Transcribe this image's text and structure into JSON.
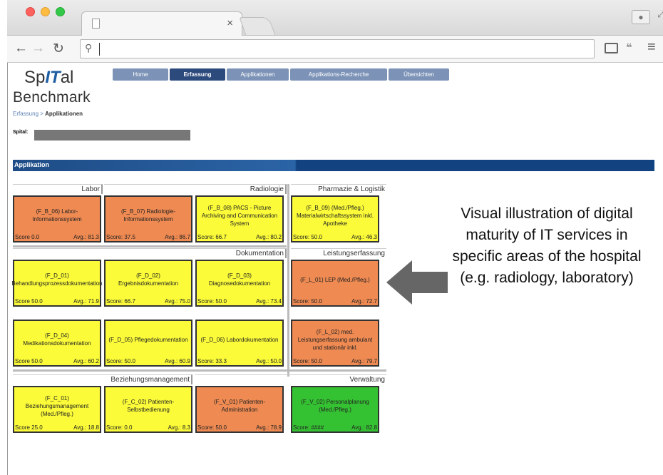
{
  "browser": {
    "tab_close": "×",
    "omnibox_value": "",
    "icons": [
      "back-icon",
      "forward-icon",
      "reload-icon",
      "search-icon",
      "cast-icon",
      "extension-icon",
      "menu-icon"
    ]
  },
  "logo": {
    "part1": "Sp",
    "part2": "IT",
    "part3": "al",
    "line2": "Benchmark"
  },
  "nav": [
    "Home",
    "Erfassung",
    "Applikationen",
    "Applikations-Recherche",
    "Übersichten"
  ],
  "breadcrumb": {
    "first": "Erfassung",
    "sep": " > ",
    "current": "Applikationen"
  },
  "spital_label": "Spital:",
  "section_title": "Applikation",
  "groups": {
    "labor": "Labor",
    "radiologie": "Radiologie",
    "pharmazie": "Pharmazie & Logistik",
    "dokumentation": "Dokumentation",
    "leistung": "Leistungserfassung",
    "beziehung": "Beziehungsmanagement",
    "verwaltung": "Verwaltung"
  },
  "cards": {
    "b06": {
      "title": "(F_B_06) Labor-Informationssystem",
      "score": "Score 0.0",
      "avg": "Avg.: 81.3"
    },
    "b07": {
      "title": "(F_B_07) Radiologie-Informationssystem",
      "score": "Score: 37.5",
      "avg": "Avg.: 86.7"
    },
    "b08": {
      "title": "(F_B_08) PACS - Picture Archiving and Communication System",
      "score": "Score: 66.7",
      "avg": "Avg.: 80.2"
    },
    "b09": {
      "title": "(F_B_09) (Med./Pfleg.) Materialwirtschaftssystem inkl. Apotheke",
      "score": "Score: 50.0",
      "avg": "Avg.: 46.3"
    },
    "d01": {
      "title": "(F_D_01) Behandlungsprozessdokumentation",
      "score": "Score 50.0",
      "avg": "Avg.: 71.9"
    },
    "d02": {
      "title": "(F_D_02) Ergebnisdokumentation",
      "score": "Score: 66.7",
      "avg": "Avg.: 75.0"
    },
    "d03": {
      "title": "(F_D_03) Diagnosedokumentation",
      "score": "Score: 50.0",
      "avg": "Avg.: 73.4"
    },
    "l01": {
      "title": "(F_L_01) LEP (Med./Pfleg.)",
      "score": "Score: 50.0",
      "avg": "Avg.: 72.7"
    },
    "d04": {
      "title": "(F_D_04) Medikationsdokumentation",
      "score": "Score 50.0",
      "avg": "Avg.: 60.2"
    },
    "d05": {
      "title": "(F_D_05) Pflegedokumentation",
      "score": "Score: 50.0",
      "avg": "Avg.: 60.9"
    },
    "d06": {
      "title": "(F_D_06) Labordokumentation",
      "score": "Score: 33.3",
      "avg": "Avg.: 50.0"
    },
    "l02": {
      "title": "(F_L_02) med. Leistungserfassung ambulant und stationär inkl.",
      "score": "Score: 50.0",
      "avg": "Avg.: 79.7"
    },
    "c01": {
      "title": "(F_C_01) Beziehungsmanagement (Med./Pfleg.)",
      "score": "Score 25.0",
      "avg": "Avg.: 18.8"
    },
    "c02": {
      "title": "(F_C_02) Patienten-Selbstbedienung",
      "score": "Score: 0.0",
      "avg": "Avg.: 8.3"
    },
    "v01": {
      "title": "(F_V_01) Patienten-Administration",
      "score": "Score: 50.0",
      "avg": "Avg.: 78.9"
    },
    "v02": {
      "title": "(F_V_02) Personalplanung (Med./Pfleg.)",
      "score": "Score: ####",
      "avg": "Avg.: 82.8"
    }
  },
  "colors": {
    "yellow": "#fbfb39",
    "orange": "#ee8a52",
    "green": "#35c232",
    "header_blue": "#1e4c86"
  },
  "annotation": "Visual illustration of digital maturity of IT services in specific areas of the hospital (e.g. radiology, laboratory)"
}
